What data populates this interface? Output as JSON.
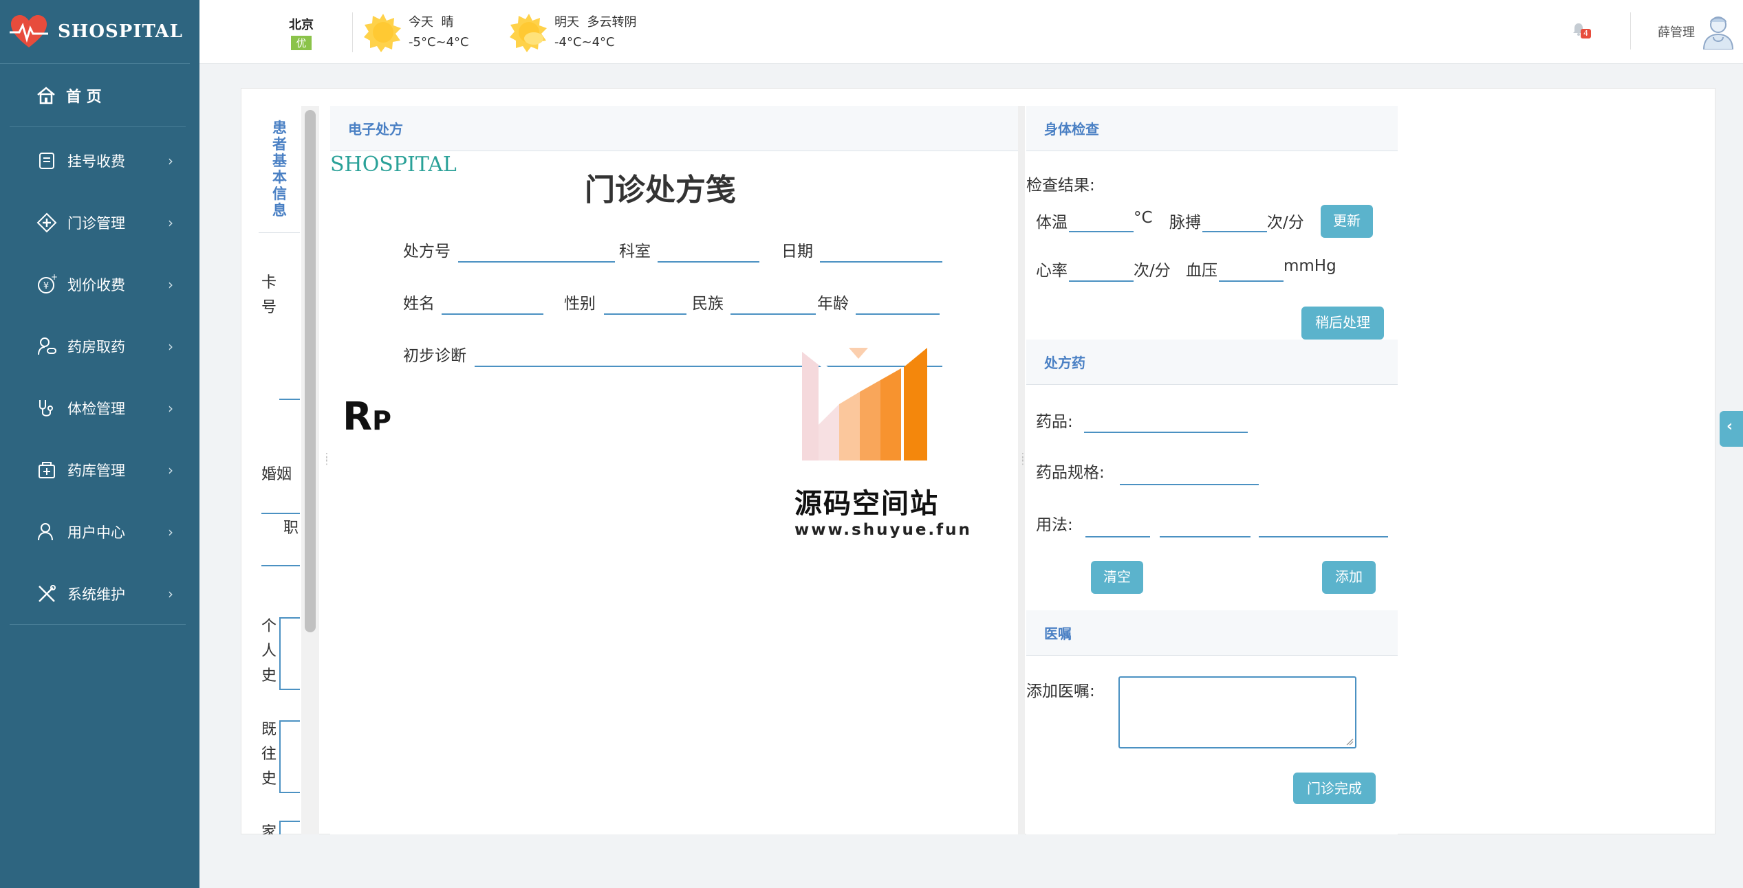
{
  "brand": {
    "name": "SHOSPITAL"
  },
  "sidebar": {
    "home": "首 页",
    "items": [
      {
        "label": "挂号收费",
        "icon": "register-icon"
      },
      {
        "label": "门诊管理",
        "icon": "clinic-icon"
      },
      {
        "label": "划价收费",
        "icon": "yen-icon"
      },
      {
        "label": "药房取药",
        "icon": "pharmacy-icon"
      },
      {
        "label": "体检管理",
        "icon": "stethoscope-icon"
      },
      {
        "label": "药库管理",
        "icon": "warehouse-icon"
      },
      {
        "label": "用户中心",
        "icon": "user-icon"
      },
      {
        "label": "系统维护",
        "icon": "tools-icon"
      }
    ]
  },
  "topbar": {
    "city": "北京",
    "air_quality": "优",
    "today": {
      "label": "今天",
      "condition": "晴",
      "temp": "-5°C~4°C"
    },
    "tomorrow": {
      "label": "明天",
      "condition": "多云转阴",
      "temp": "-4°C~4°C"
    },
    "notification_count": "4",
    "user_name": "薛管理"
  },
  "patient": {
    "title": "患者基本信息",
    "card_no": "卡号",
    "marriage": "婚姻",
    "job": "职",
    "personal_history": "个人史",
    "past_history": "既往史",
    "family": "家"
  },
  "prescription": {
    "header": "电子处方",
    "logo": "SHOSPITAL",
    "title": "门诊处方笺",
    "rx_no": "处方号",
    "dept": "科室",
    "date": "日期",
    "name": "姓名",
    "sex": "性别",
    "ethnic": "民族",
    "age": "年龄",
    "diagnosis": "初步诊断",
    "rp_r": "R",
    "rp_p": "P"
  },
  "watermark": {
    "title": "源码空间站",
    "url": "www.shuyue.fun"
  },
  "exam": {
    "header": "身体检查",
    "result_label": "检查结果:",
    "temp": "体温",
    "temp_unit": "°C",
    "pulse": "脉搏",
    "pulse_unit": "次/分",
    "heart": "心率",
    "heart_unit": "次/分",
    "bp": "血压",
    "bp_unit": "mmHg",
    "update_btn": "更新",
    "later_btn": "稍后处理"
  },
  "medicine": {
    "header": "处方药",
    "drug": "药品:",
    "spec": "药品规格:",
    "usage": "用法:",
    "clear_btn": "清空",
    "add_btn": "添加"
  },
  "advice": {
    "header": "医嘱",
    "add_label": "添加医嘱:",
    "finish_btn": "门诊完成"
  },
  "side_tab": "‹"
}
